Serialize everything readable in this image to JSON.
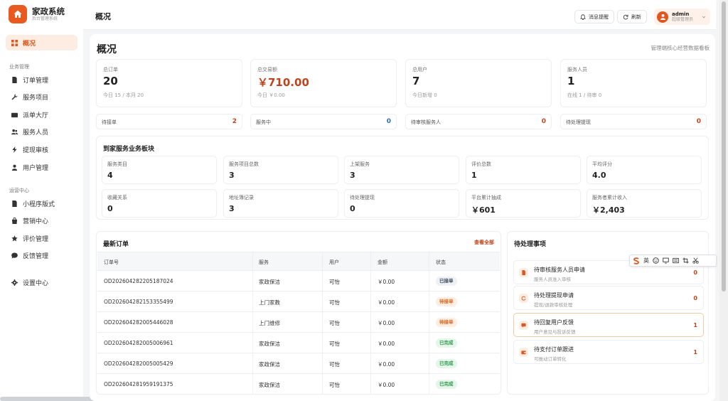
{
  "brand": {
    "title": "家政系统",
    "subtitle": "后台管理系统"
  },
  "sidebar": {
    "overview": "概况",
    "group_business": "业务管理",
    "business_items": [
      "订单管理",
      "服务项目",
      "派单大厅",
      "服务人员",
      "提现审核",
      "用户管理"
    ],
    "group_ops": "运营中心",
    "ops_items": [
      "小程序版式",
      "营销中心",
      "评价管理",
      "反馈管理"
    ],
    "settings": "设置中心"
  },
  "header": {
    "title": "概况",
    "notify_label": "消息提醒",
    "refresh_label": "刷新",
    "user_name": "admin",
    "user_role": "超级管理员"
  },
  "page": {
    "title": "概况",
    "description": "管理端核心经营数据看板"
  },
  "stats": [
    {
      "label": "总订单",
      "value": "20",
      "sub": "今日 15 / 本月 20"
    },
    {
      "label": "总交易额",
      "value": "￥710.00",
      "sub": "今日 ￥0.00"
    },
    {
      "label": "总用户",
      "value": "7",
      "sub": "今日新增 0"
    },
    {
      "label": "服务人员",
      "value": "1",
      "sub": "在线 1 / 待审 0"
    }
  ],
  "mini_stats": [
    {
      "label": "待接单",
      "value": "2",
      "color": "#c0441a"
    },
    {
      "label": "服务中",
      "value": "0",
      "color": "#2a6fb0"
    },
    {
      "label": "待审核服务人",
      "value": "0",
      "color": "#c0441a"
    },
    {
      "label": "待处理提现",
      "value": "0",
      "color": "#c0441a"
    }
  ],
  "business": {
    "title": "到家服务业务板块",
    "cards": [
      {
        "label": "服务类目",
        "value": "4"
      },
      {
        "label": "服务项目总数",
        "value": "3"
      },
      {
        "label": "上架服务",
        "value": "3"
      },
      {
        "label": "评价总数",
        "value": "1"
      },
      {
        "label": "平均评分",
        "value": "4.0"
      },
      {
        "label": "收藏关系",
        "value": "0"
      },
      {
        "label": "地址簿记录",
        "value": "3"
      },
      {
        "label": "待处理提现",
        "value": "0"
      },
      {
        "label": "平台累计抽成",
        "value": "￥601"
      },
      {
        "label": "服务者累计收入",
        "value": "￥2,403"
      }
    ]
  },
  "orders": {
    "title": "最新订单",
    "view_all": "查看全部",
    "columns": [
      "订单号",
      "服务",
      "用户",
      "金额",
      "状态"
    ],
    "rows": [
      {
        "id": "OD202604282205187024",
        "service": "家政保洁",
        "user": "可怡",
        "amount": "￥0.00",
        "status": "已接单",
        "tone": "b-blue"
      },
      {
        "id": "OD202604282153355499",
        "service": "上门家教",
        "user": "可怡",
        "amount": "￥0.00",
        "status": "待接单",
        "tone": "b-orange"
      },
      {
        "id": "OD202604282005446028",
        "service": "上门维修",
        "user": "可怡",
        "amount": "￥0.00",
        "status": "待接单",
        "tone": "b-orange"
      },
      {
        "id": "OD202604282005006961",
        "service": "家政保洁",
        "user": "可怡",
        "amount": "￥0.00",
        "status": "已完成",
        "tone": "b-green"
      },
      {
        "id": "OD202604282005005429",
        "service": "家政保洁",
        "user": "可怡",
        "amount": "￥0.00",
        "status": "已完成",
        "tone": "b-green"
      },
      {
        "id": "OD202604281959191375",
        "service": "家政保洁",
        "user": "可怡",
        "amount": "￥0.00",
        "status": "已完成",
        "tone": "b-green"
      }
    ]
  },
  "tasks": {
    "title": "待处理事项",
    "items": [
      {
        "title": "待审核服务人员申请",
        "sub": "服务人员准入审核",
        "count": "0"
      },
      {
        "title": "待处理提现申请",
        "sub": "提现/退款审核处理",
        "count": "0"
      },
      {
        "title": "待回复用户反馈",
        "sub": "用户意见与投诉反馈",
        "count": "1"
      },
      {
        "title": "待支付订单跟进",
        "sub": "可推动订单转化",
        "count": "1"
      }
    ]
  },
  "ime": {
    "lang_label": "英"
  }
}
